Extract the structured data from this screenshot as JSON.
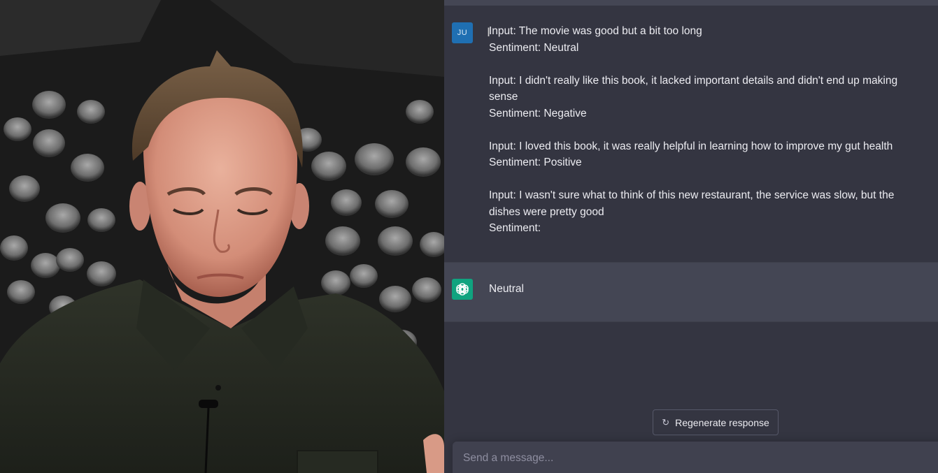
{
  "conversation": {
    "user": {
      "avatar_initials": "JU",
      "lines": [
        "Input: The movie was good but a bit too long",
        "Sentiment: Neutral",
        "",
        "Input: I didn't really like this book, it lacked important details and didn't end up making",
        "sense",
        "Sentiment: Negative",
        "",
        "Input: I loved this book, it was really helpful in learning how to improve my gut health",
        "Sentiment: Positive",
        "",
        "Input: I wasn't sure what to think of this new restaurant, the service was slow, but the",
        "dishes were pretty good",
        "Sentiment:"
      ]
    },
    "assistant": {
      "avatar_icon": "openai-logo-icon",
      "reply": "Neutral"
    }
  },
  "regenerate": {
    "label": "Regenerate response",
    "icon": "refresh-icon"
  },
  "composer": {
    "placeholder": "Send a message...",
    "value": ""
  },
  "colors": {
    "background": "#343541",
    "assistant_row": "#444654",
    "user_avatar": "#1f6fb2",
    "assistant_avatar": "#10a37f",
    "composer": "#40414f"
  }
}
